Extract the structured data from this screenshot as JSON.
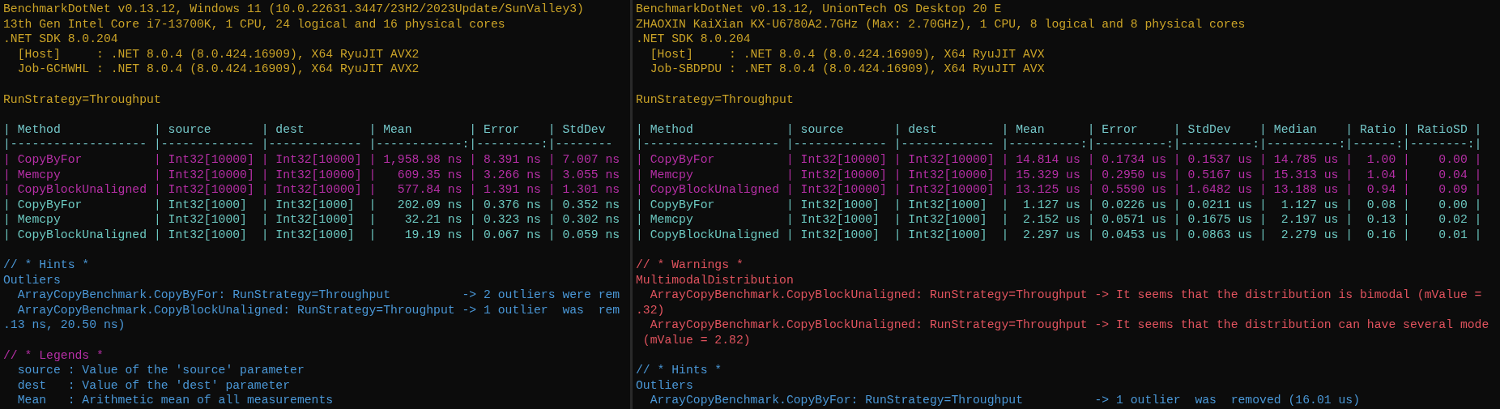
{
  "panes": [
    {
      "lines": [
        {
          "kind": "info",
          "text": "BenchmarkDotNet v0.13.12, Windows 11 (10.0.22631.3447/23H2/2023Update/SunValley3)"
        },
        {
          "kind": "info",
          "text": "13th Gen Intel Core i7-13700K, 1 CPU, 24 logical and 16 physical cores"
        },
        {
          "kind": "info",
          "text": ".NET SDK 8.0.204"
        },
        {
          "kind": "info",
          "text": "  [Host]     : .NET 8.0.4 (8.0.424.16909), X64 RyuJIT AVX2"
        },
        {
          "kind": "info",
          "text": "  Job-GCHWHL : .NET 8.0.4 (8.0.424.16909), X64 RyuJIT AVX2"
        },
        {
          "kind": "blank"
        },
        {
          "kind": "info",
          "text": "RunStrategy=Throughput"
        },
        {
          "kind": "blank"
        },
        {
          "kind": "tablehead",
          "text": "| Method             | source       | dest         | Mean        | Error    | StdDev"
        },
        {
          "kind": "tablehead",
          "text": "|------------------- |------------- |------------- |------------:|---------:|--------"
        },
        {
          "kind": "rowhl",
          "text": "| CopyByFor          | Int32[10000] | Int32[10000] | 1,958.98 ns | 8.391 ns | 7.007 ns"
        },
        {
          "kind": "rowhl",
          "text": "| Memcpy             | Int32[10000] | Int32[10000] |   609.35 ns | 3.266 ns | 3.055 ns"
        },
        {
          "kind": "rowhl",
          "text": "| CopyBlockUnaligned | Int32[10000] | Int32[10000] |   577.84 ns | 1.391 ns | 1.301 ns"
        },
        {
          "kind": "row",
          "text": "| CopyByFor          | Int32[1000]  | Int32[1000]  |   202.09 ns | 0.376 ns | 0.352 ns"
        },
        {
          "kind": "row",
          "text": "| Memcpy             | Int32[1000]  | Int32[1000]  |    32.21 ns | 0.323 ns | 0.302 ns"
        },
        {
          "kind": "row",
          "text": "| CopyBlockUnaligned | Int32[1000]  | Int32[1000]  |    19.19 ns | 0.067 ns | 0.059 ns"
        },
        {
          "kind": "blank"
        },
        {
          "kind": "hint",
          "text": "// * Hints *"
        },
        {
          "kind": "hint",
          "text": "Outliers"
        },
        {
          "kind": "hint",
          "text": "  ArrayCopyBenchmark.CopyByFor: RunStrategy=Throughput          -> 2 outliers were rem"
        },
        {
          "kind": "hint",
          "text": "  ArrayCopyBenchmark.CopyBlockUnaligned: RunStrategy=Throughput -> 1 outlier  was  rem"
        },
        {
          "kind": "hint",
          "text": ".13 ns, 20.50 ns)"
        },
        {
          "kind": "blank"
        },
        {
          "kind": "accent",
          "text": "// * Legends *"
        },
        {
          "kind": "hint",
          "text": "  source : Value of the 'source' parameter"
        },
        {
          "kind": "hint",
          "text": "  dest   : Value of the 'dest' parameter"
        },
        {
          "kind": "hint",
          "text": "  Mean   : Arithmetic mean of all measurements"
        }
      ]
    },
    {
      "lines": [
        {
          "kind": "info",
          "text": "BenchmarkDotNet v0.13.12, UnionTech OS Desktop 20 E"
        },
        {
          "kind": "info",
          "text": "ZHAOXIN KaiXian KX-U6780A2.7GHz (Max: 2.70GHz), 1 CPU, 8 logical and 8 physical cores"
        },
        {
          "kind": "info",
          "text": ".NET SDK 8.0.204"
        },
        {
          "kind": "info",
          "text": "  [Host]     : .NET 8.0.4 (8.0.424.16909), X64 RyuJIT AVX"
        },
        {
          "kind": "info",
          "text": "  Job-SBDPDU : .NET 8.0.4 (8.0.424.16909), X64 RyuJIT AVX"
        },
        {
          "kind": "blank"
        },
        {
          "kind": "info",
          "text": "RunStrategy=Throughput"
        },
        {
          "kind": "blank"
        },
        {
          "kind": "tablehead",
          "text": "| Method             | source       | dest         | Mean      | Error     | StdDev    | Median    | Ratio | RatioSD |"
        },
        {
          "kind": "tablehead",
          "text": "|------------------- |------------- |------------- |----------:|----------:|----------:|----------:|------:|--------:|"
        },
        {
          "kind": "rowhl",
          "text": "| CopyByFor          | Int32[10000] | Int32[10000] | 14.814 us | 0.1734 us | 0.1537 us | 14.785 us |  1.00 |    0.00 |"
        },
        {
          "kind": "rowhl",
          "text": "| Memcpy             | Int32[10000] | Int32[10000] | 15.329 us | 0.2950 us | 0.5167 us | 15.313 us |  1.04 |    0.04 |"
        },
        {
          "kind": "rowhl",
          "text": "| CopyBlockUnaligned | Int32[10000] | Int32[10000] | 13.125 us | 0.5590 us | 1.6482 us | 13.188 us |  0.94 |    0.09 |"
        },
        {
          "kind": "row",
          "text": "| CopyByFor          | Int32[1000]  | Int32[1000]  |  1.127 us | 0.0226 us | 0.0211 us |  1.127 us |  0.08 |    0.00 |"
        },
        {
          "kind": "row",
          "text": "| Memcpy             | Int32[1000]  | Int32[1000]  |  2.152 us | 0.0571 us | 0.1675 us |  2.197 us |  0.13 |    0.02 |"
        },
        {
          "kind": "row",
          "text": "| CopyBlockUnaligned | Int32[1000]  | Int32[1000]  |  2.297 us | 0.0453 us | 0.0863 us |  2.279 us |  0.16 |    0.01 |"
        },
        {
          "kind": "blank"
        },
        {
          "kind": "warning",
          "text": "// * Warnings *"
        },
        {
          "kind": "warning",
          "text": "MultimodalDistribution"
        },
        {
          "kind": "warning",
          "text": "  ArrayCopyBenchmark.CopyBlockUnaligned: RunStrategy=Throughput -> It seems that the distribution is bimodal (mValue ="
        },
        {
          "kind": "warning",
          "text": ".32)"
        },
        {
          "kind": "warning",
          "text": "  ArrayCopyBenchmark.CopyBlockUnaligned: RunStrategy=Throughput -> It seems that the distribution can have several mode"
        },
        {
          "kind": "warning",
          "text": " (mValue = 2.82)"
        },
        {
          "kind": "blank"
        },
        {
          "kind": "hint",
          "text": "// * Hints *"
        },
        {
          "kind": "hint",
          "text": "Outliers"
        },
        {
          "kind": "hint",
          "text": "  ArrayCopyBenchmark.CopyByFor: RunStrategy=Throughput          -> 1 outlier  was  removed (16.01 us)"
        }
      ]
    }
  ]
}
